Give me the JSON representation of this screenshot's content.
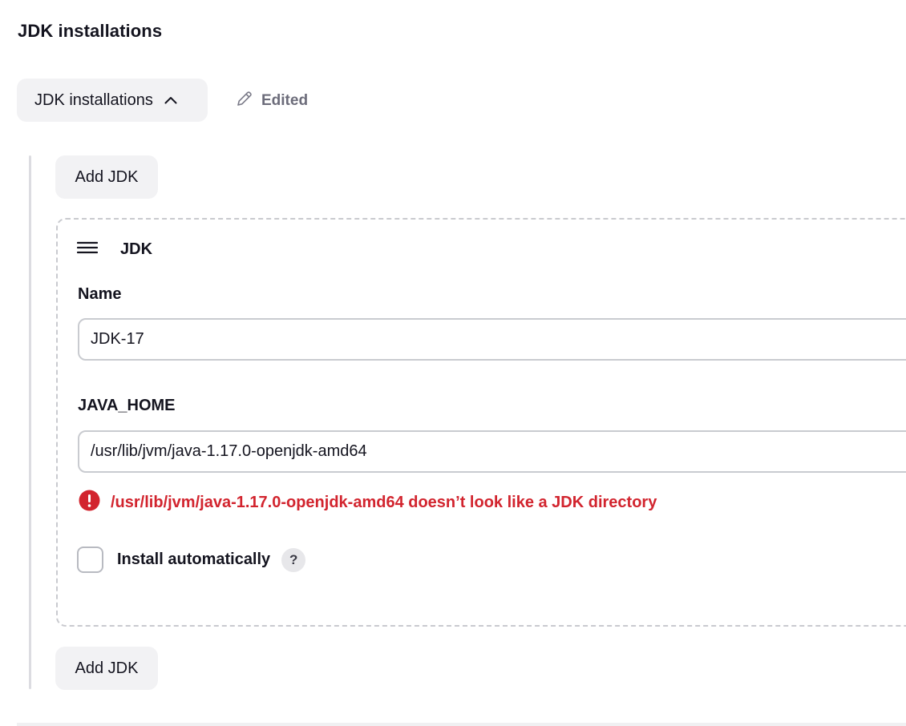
{
  "section": {
    "title": "JDK installations"
  },
  "toggle": {
    "label": "JDK installations",
    "icon": "chevron-up-icon"
  },
  "status": {
    "label": "Edited",
    "icon": "pencil-icon"
  },
  "add_button": {
    "label": "Add JDK"
  },
  "jdk_item": {
    "title": "JDK",
    "drag_icon": "drag-handle-icon",
    "name": {
      "label": "Name",
      "value": "JDK-17"
    },
    "java_home": {
      "label": "JAVA_HOME",
      "value": "/usr/lib/jvm/java-1.17.0-openjdk-amd64",
      "error": "/usr/lib/jvm/java-1.17.0-openjdk-amd64 doesn’t look like a JDK directory",
      "error_icon": "error-icon"
    },
    "install_automatically": {
      "label": "Install automatically",
      "checked": false,
      "help": "?"
    }
  },
  "colors": {
    "error": "#d2242e",
    "button_bg": "#f2f2f4",
    "border": "#c9cbd0",
    "muted_text": "#6c6c7a"
  }
}
